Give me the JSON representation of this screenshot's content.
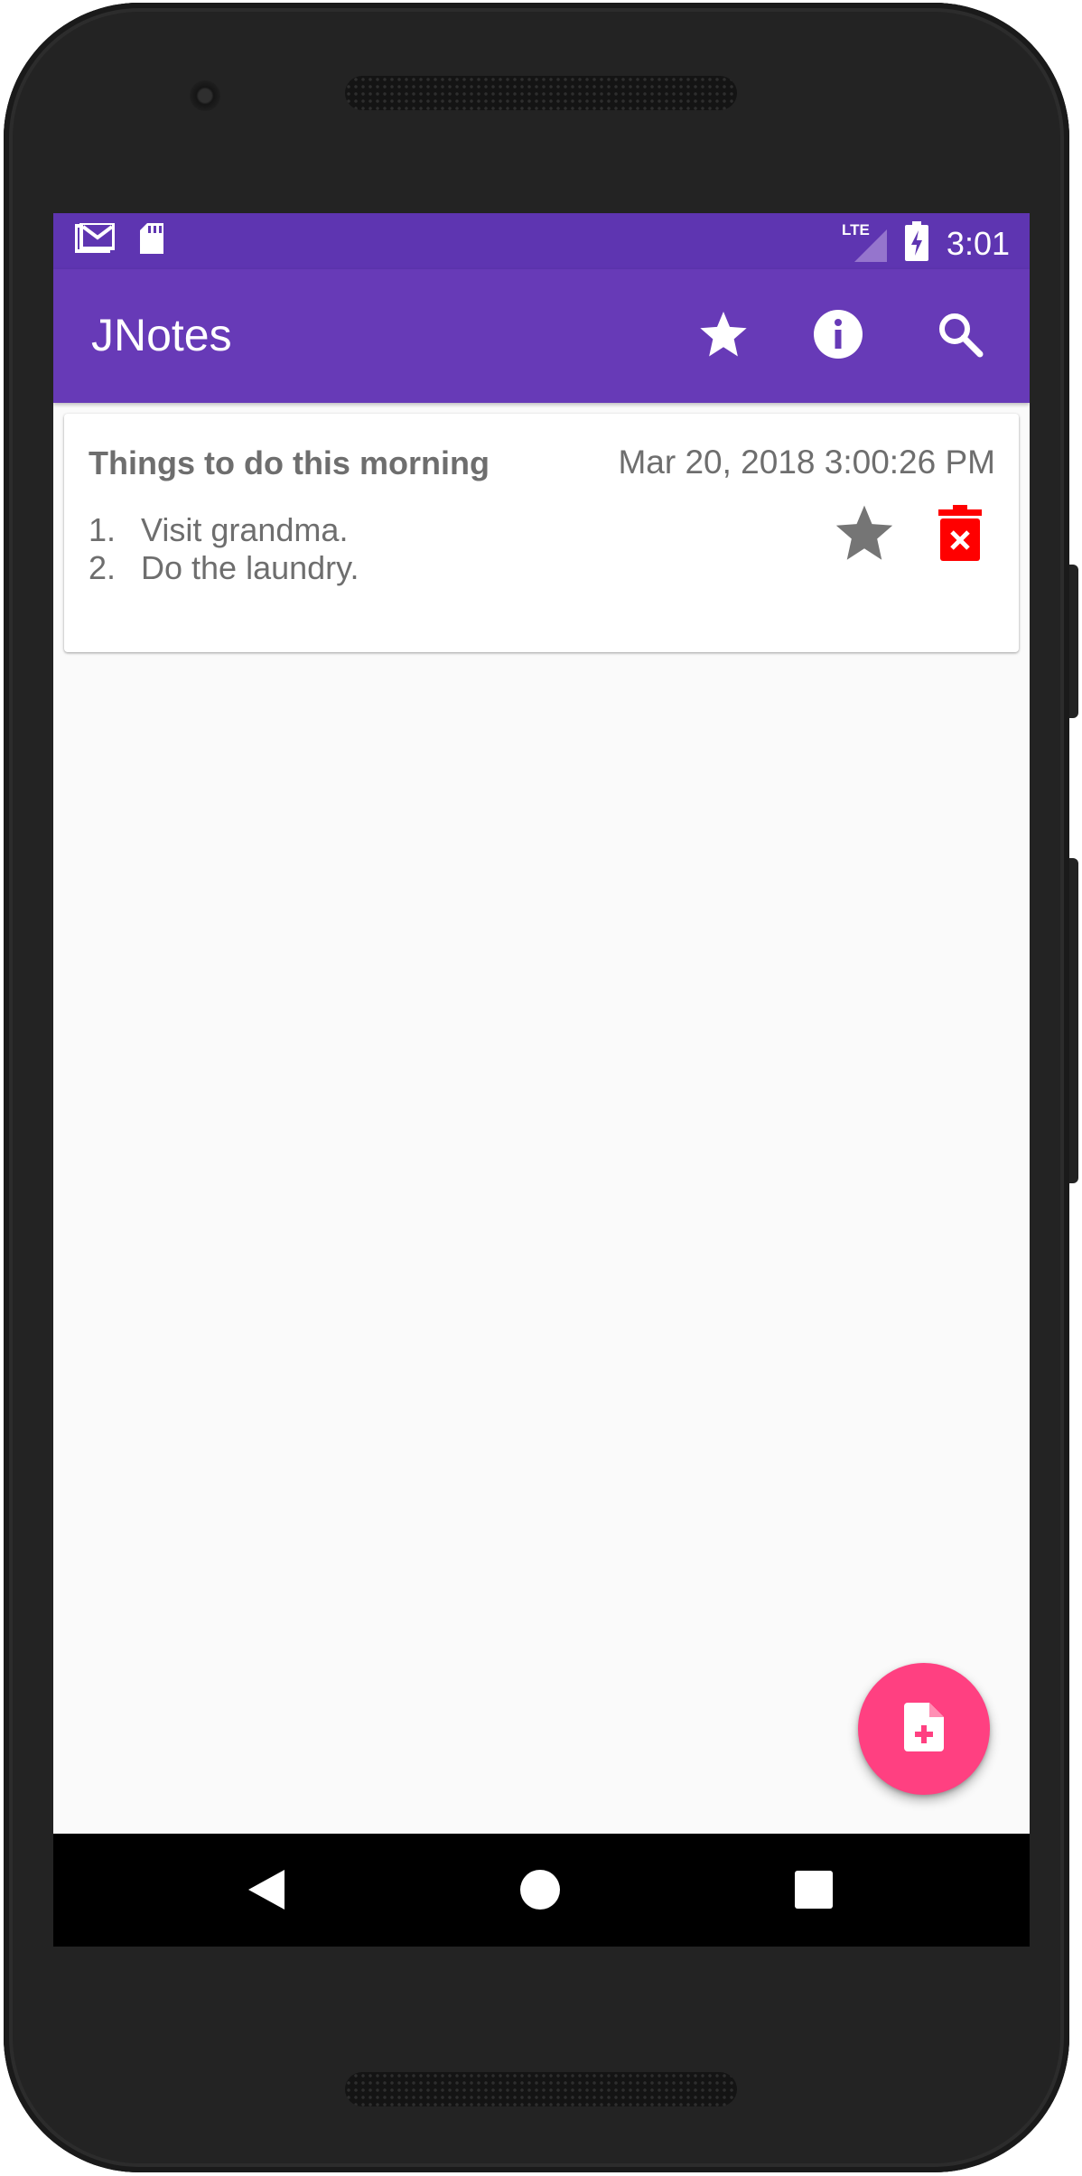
{
  "status_bar": {
    "time": "3:01",
    "network": "LTE",
    "icons": [
      "gmail-icon",
      "sd-card-icon",
      "lte-signal-icon",
      "battery-charging-icon"
    ]
  },
  "app_bar": {
    "title": "JNotes",
    "actions": [
      "star-icon",
      "info-icon",
      "search-icon"
    ],
    "color": "#673ab7",
    "status_color": "#5e35b1"
  },
  "notes": [
    {
      "title": "Things to do this morning",
      "date": "Mar 20, 2018 3:00:26 PM",
      "items": [
        {
          "num": "1.",
          "text": "Visit grandma."
        },
        {
          "num": "2.",
          "text": "Do the laundry."
        }
      ],
      "icons": [
        "star-icon",
        "delete-icon"
      ]
    }
  ],
  "fab": {
    "icon": "add-note-icon",
    "color": "#ff4081"
  },
  "nav_bar": {
    "icons": [
      "back-icon",
      "home-icon",
      "recents-icon"
    ]
  }
}
